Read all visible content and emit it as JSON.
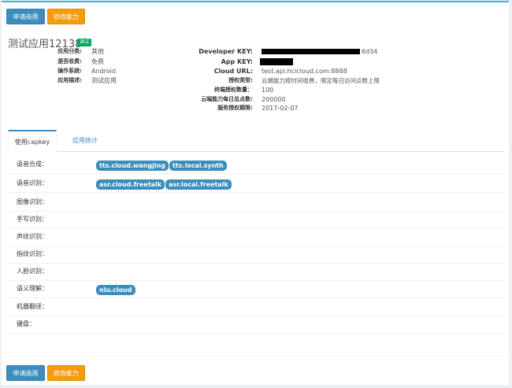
{
  "toolbar": {
    "apply_commercial": "申请商用",
    "modify_capability": "修改能力"
  },
  "app": {
    "name": "测试应用12138",
    "status_badge": "调试",
    "left_info": [
      {
        "label": "应用分类:",
        "value": "其他"
      },
      {
        "label": "是否收费:",
        "value": "免费"
      },
      {
        "label": "操作系统:",
        "value": "Android"
      },
      {
        "label": "应用描述:",
        "value": "测试应用"
      }
    ],
    "right_info": [
      {
        "label": "Developer KEY:",
        "value": "6d34"
      },
      {
        "label": "App KEY:",
        "value": ""
      },
      {
        "label": "Cloud URL:",
        "value": "test.api.hcicloud.com:8888"
      },
      {
        "label": "授权类型:",
        "value": "云端能力按时间收费，限定每日访问点数上限"
      },
      {
        "label": "终端授权数量：",
        "value": "100"
      },
      {
        "label": "云端能力每日总点数:",
        "value": "200000"
      },
      {
        "label": "服务授权期限:",
        "value": "2017-02-07"
      }
    ]
  },
  "tabs": [
    {
      "label": "使用capkey",
      "active": true
    },
    {
      "label": "应用统计",
      "active": false
    }
  ],
  "capabilities": [
    {
      "label": "语音合成：",
      "tags": [
        "tts.cloud.wangjing",
        "tts.local.synth"
      ]
    },
    {
      "label": "语音识别：",
      "tags": [
        "asr.cloud.freetalk",
        "asr.local.freetalk"
      ]
    },
    {
      "label": "图像识别：",
      "tags": []
    },
    {
      "label": "手写识别：",
      "tags": []
    },
    {
      "label": "声纹识别：",
      "tags": []
    },
    {
      "label": "指纹识别：",
      "tags": []
    },
    {
      "label": "人脸识别：",
      "tags": []
    },
    {
      "label": "语义理解：",
      "tags": [
        "nlu.cloud"
      ]
    },
    {
      "label": "机器翻译：",
      "tags": []
    },
    {
      "label": "键盘：",
      "tags": []
    }
  ],
  "colors": {
    "primary": "#3c8dbc",
    "warning": "#f39c12",
    "success": "#00a65a",
    "accent_bar": "#3bb7d3"
  }
}
